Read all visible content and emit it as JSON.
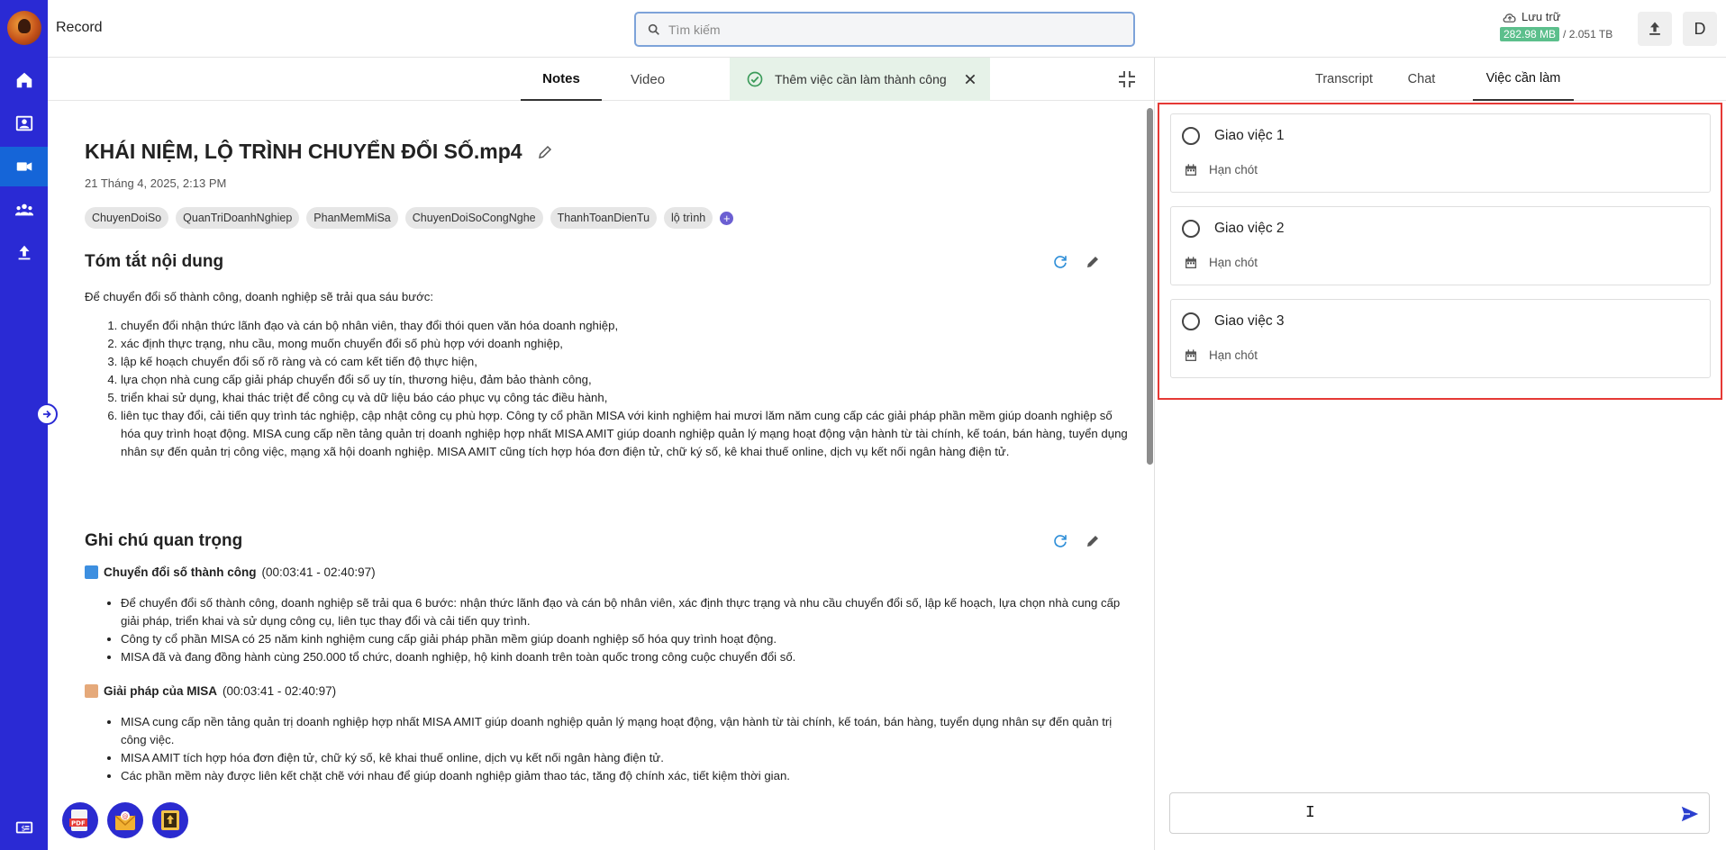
{
  "app": {
    "title": "Record"
  },
  "search": {
    "placeholder": "Tìm kiếm"
  },
  "storage": {
    "label": "Lưu trữ",
    "used": "282.98 MB",
    "total": "/ 2.051 TB"
  },
  "user": {
    "initial": "D"
  },
  "rail": {
    "icons": [
      "home-icon",
      "contacts-icon",
      "video-icon",
      "team-icon",
      "upload-icon",
      "billing-icon"
    ],
    "active": "video-icon"
  },
  "left_tabs": [
    {
      "label": "Notes",
      "active": true
    },
    {
      "label": "Video",
      "active": false
    }
  ],
  "toast": {
    "message": "Thêm việc cần làm thành công"
  },
  "doc": {
    "title": "KHÁI NIỆM, LỘ TRÌNH CHUYỂN ĐỔI SỐ.mp4",
    "date": "21 Tháng 4, 2025, 2:13 PM",
    "tags": [
      "ChuyenDoiSo",
      "QuanTriDoanhNghiep",
      "PhanMemMiSa",
      "ChuyenDoiSoCongNghe",
      "ThanhToanDienTu",
      "lộ trình"
    ],
    "summary_title": "Tóm tắt nội dung",
    "summary_intro": "Để chuyển đổi số thành công, doanh nghiệp sẽ trải qua sáu bước:",
    "steps": [
      "chuyển đổi nhận thức lãnh đạo và cán bộ nhân viên, thay đổi thói quen văn hóa doanh nghiệp,",
      "xác định thực trạng, nhu cầu, mong muốn chuyển đổi số phù hợp với doanh nghiệp,",
      "lập kế hoạch chuyển đổi số rõ ràng và có cam kết tiến độ thực hiện,",
      "lựa chọn nhà cung cấp giải pháp chuyển đổi số uy tín, thương hiệu, đảm bảo thành công,",
      "triển khai sử dụng, khai thác triệt để công cụ và dữ liệu báo cáo phục vụ công tác điều hành,",
      "liên tục thay đổi, cải tiến quy trình tác nghiệp, cập nhật công cụ phù hợp. Công ty cổ phần MISA với kinh nghiệm hai mươi lăm năm cung cấp các giải pháp phần mềm giúp doanh nghiệp số hóa quy trình hoạt động. MISA cung cấp nền tảng quản trị doanh nghiệp hợp nhất MISA AMIT giúp doanh nghiệp quản lý mạng hoạt động vận hành từ tài chính, kế toán, bán hàng, tuyển dụng nhân sự đến quản trị công việc, mạng xã hội doanh nghiệp. MISA AMIT cũng tích hợp hóa đơn điện tử, chữ ký số, kê khai thuế online, dịch vụ kết nối ngân hàng điện tử."
    ],
    "notes_title": "Ghi chú quan trọng",
    "note1_head": "Chuyển đổi số thành công",
    "note1_time": "(00:03:41 - 02:40:97)",
    "note1_items": [
      "Để chuyển đổi số thành công, doanh nghiệp sẽ trải qua 6 bước: nhận thức lãnh đạo và cán bộ nhân viên, xác định thực trạng và nhu cầu chuyển đổi số, lập kế hoạch, lựa chọn nhà cung cấp giải pháp, triển khai và sử dụng công cụ, liên tục thay đổi và cải tiến quy trình.",
      "Công ty cổ phần MISA có 25 năm kinh nghiệm cung cấp giải pháp phần mềm giúp doanh nghiệp số hóa quy trình hoạt động.",
      "MISA đã và đang đồng hành cùng 250.000 tổ chức, doanh nghiệp, hộ kinh doanh trên toàn quốc trong công cuộc chuyển đổi số."
    ],
    "note2_head": "Giải pháp của MISA",
    "note2_time": "(00:03:41 - 02:40:97)",
    "note2_items": [
      "MISA cung cấp nền tảng quản trị doanh nghiệp hợp nhất MISA AMIT giúp doanh nghiệp quản lý mạng hoạt động, vận hành từ tài chính, kế toán, bán hàng, tuyển dụng nhân sự đến quản trị công việc.",
      "MISA AMIT tích hợp hóa đơn điện tử, chữ ký số, kê khai thuế online, dịch vụ kết nối ngân hàng điện tử.",
      "Các phần mềm này được liên kết chặt chẽ với nhau để giúp doanh nghiệp giảm thao tác, tăng độ chính xác, tiết kiệm thời gian."
    ]
  },
  "right_tabs": [
    {
      "label": "Transcript",
      "active": false
    },
    {
      "label": "Chat",
      "active": false
    },
    {
      "label": "Việc cần làm",
      "active": true
    }
  ],
  "tasks": [
    {
      "name": "Giao việc 1",
      "due_label": "Hạn chót"
    },
    {
      "name": "Giao việc 2",
      "due_label": "Hạn chót"
    },
    {
      "name": "Giao việc 3",
      "due_label": "Hạn chót"
    }
  ],
  "fabs": [
    {
      "icon": "pdf-export-icon",
      "label": "PDF"
    },
    {
      "icon": "email-export-icon"
    },
    {
      "icon": "upload-export-icon"
    }
  ],
  "colors": {
    "rail": "#2a2ad4",
    "rail_active": "#1565d8",
    "accent": "#6b5fd2",
    "highlight": "#e53935",
    "toast_bg": "#e6f2e8",
    "storage_used": "#5cbf8c"
  }
}
